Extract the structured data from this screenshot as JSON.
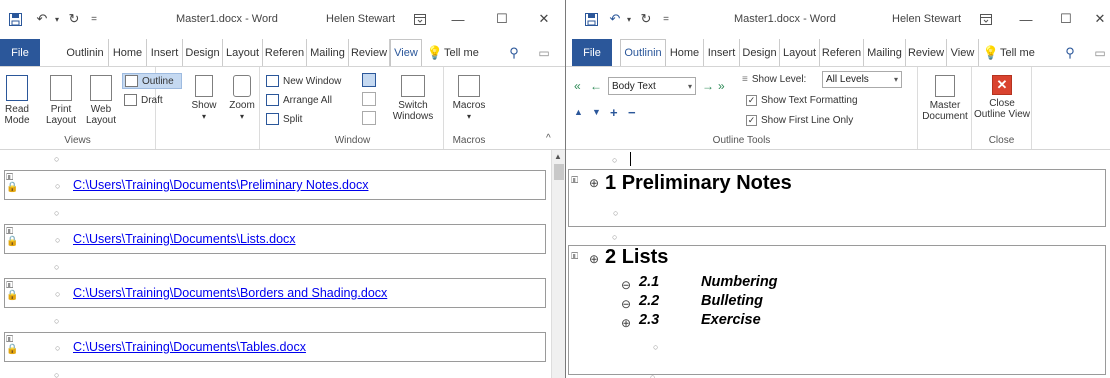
{
  "left": {
    "title": "Master1.docx  -  Word",
    "user": "Helen Stewart",
    "file_tab": "File",
    "tabs": [
      "Outlinin",
      "Home",
      "Insert",
      "Design",
      "Layout",
      "Referen",
      "Mailing",
      "Review",
      "View"
    ],
    "selected_tab": "View",
    "tell_me": "Tell me",
    "ribbon": {
      "views": {
        "group_label": "Views",
        "read_mode": [
          "Read",
          "Mode"
        ],
        "print_layout": [
          "Print",
          "Layout"
        ],
        "web_layout": [
          "Web",
          "Layout"
        ],
        "outline": "Outline",
        "draft": "Draft"
      },
      "show": "Show",
      "zoom": "Zoom",
      "window": {
        "group_label": "Window",
        "new_window": "New Window",
        "arrange_all": "Arrange All",
        "split": "Split",
        "switch_windows": [
          "Switch",
          "Windows"
        ]
      },
      "macros": {
        "group_label": "Macros",
        "label": "Macros"
      }
    },
    "subdocs": [
      "C:\\Users\\Training\\Documents\\Preliminary Notes.docx",
      "C:\\Users\\Training\\Documents\\Lists.docx",
      "C:\\Users\\Training\\Documents\\Borders and Shading.docx",
      "C:\\Users\\Training\\Documents\\Tables.docx"
    ]
  },
  "right": {
    "title": "Master1.docx  -  Word",
    "user": "Helen Stewart",
    "file_tab": "File",
    "tabs": [
      "Outlinin",
      "Home",
      "Insert",
      "Design",
      "Layout",
      "Referen",
      "Mailing",
      "Review",
      "View"
    ],
    "selected_tab": "Outlinin",
    "tell_me": "Tell me",
    "ribbon": {
      "outline_tools": {
        "group_label": "Outline Tools",
        "level_value": "Body Text",
        "show_level_label": "Show Level:",
        "show_level_value": "All Levels",
        "show_text_formatting": "Show Text Formatting",
        "show_first_line_only": "Show First Line Only"
      },
      "master_document": [
        "Master",
        "Document"
      ],
      "close": {
        "group_label": "Close",
        "label": [
          "Close",
          "Outline View"
        ]
      }
    },
    "outline": {
      "sections": [
        {
          "num": "1",
          "title": "Preliminary Notes"
        },
        {
          "num": "2",
          "title": "Lists"
        }
      ],
      "subheadings": [
        {
          "num": "2.1",
          "title": "Numbering",
          "icon": "minus"
        },
        {
          "num": "2.2",
          "title": "Bulleting",
          "icon": "minus"
        },
        {
          "num": "2.3",
          "title": "Exercise",
          "icon": "plus"
        }
      ]
    }
  }
}
